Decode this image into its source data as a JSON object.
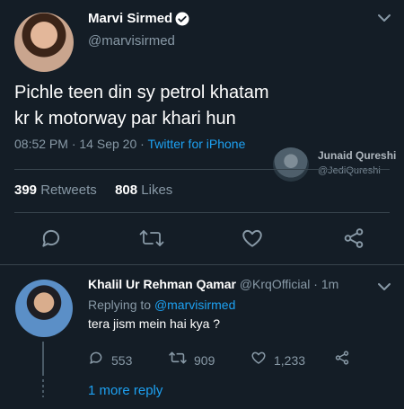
{
  "main_tweet": {
    "author_name": "Marvi Sirmed",
    "author_handle": "@marvisirmed",
    "text": "Pichle teen din sy petrol khatam kr k motorway par khari hun",
    "time": "08:52 PM",
    "sep": "·",
    "date": "14 Sep 20",
    "source": "Twitter for iPhone",
    "retweets_count": "399",
    "retweets_label": "Retweets",
    "likes_count": "808",
    "likes_label": "Likes"
  },
  "watermark": {
    "name": "Junaid Qureshi",
    "handle": "@JediQureshi"
  },
  "reply": {
    "author_name": "Khalil Ur Rehman Qamar",
    "author_handle": "@KrqOfficial",
    "sep": "·",
    "age": "1m",
    "replying_to_label": "Replying to",
    "replying_to_handle": "@marvisirmed",
    "text": "tera jism mein hai kya ?",
    "replies_count": "553",
    "retweets_count": "909",
    "likes_count": "1,233",
    "more_replies": "1 more reply"
  },
  "colors": {
    "background": "#141d26",
    "accent": "#1da1f2",
    "muted": "#8899a6",
    "divider": "#38444d"
  },
  "icons": [
    "verified-badge-icon",
    "chevron-down-icon",
    "reply-icon",
    "retweet-icon",
    "like-icon",
    "share-icon"
  ]
}
